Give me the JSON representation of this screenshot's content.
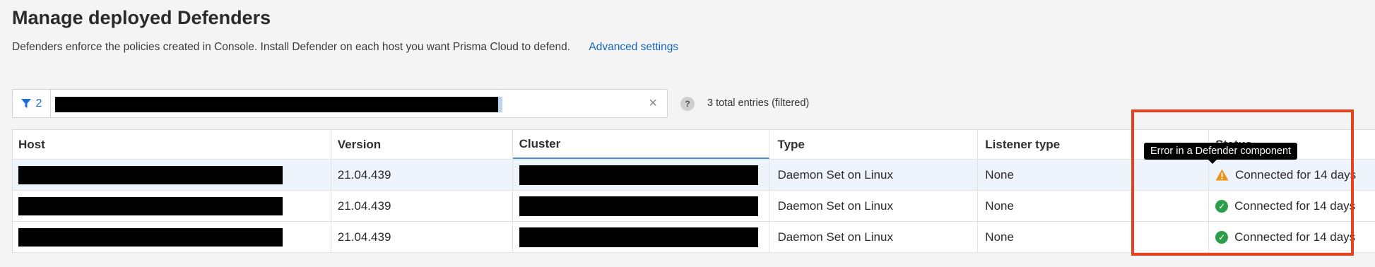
{
  "page": {
    "title": "Manage deployed Defenders",
    "description": "Defenders enforce the policies created in Console. Install Defender on each host you want Prisma Cloud to defend.",
    "advanced_link": "Advanced settings"
  },
  "filter": {
    "count": "2",
    "value": "",
    "clear_symbol": "×",
    "help_symbol": "?",
    "entries_text": "3 total entries (filtered)"
  },
  "table": {
    "columns": [
      "Host",
      "Version",
      "Cluster",
      "Type",
      "Listener type",
      "Status"
    ],
    "rows": [
      {
        "version": "21.04.439",
        "type": "Daemon Set on Linux",
        "listener": "None",
        "status": "Connected for 14 days",
        "status_icon": "warning-icon"
      },
      {
        "version": "21.04.439",
        "type": "Daemon Set on Linux",
        "listener": "None",
        "status": "Connected for 14 days",
        "status_icon": "check-circle-icon"
      },
      {
        "version": "21.04.439",
        "type": "Daemon Set on Linux",
        "listener": "None",
        "status": "Connected for 14 days",
        "status_icon": "check-circle-icon"
      }
    ]
  },
  "tooltip": {
    "text": "Error in a Defender component"
  },
  "colors": {
    "accent": "#1e6fd9",
    "success": "#2e9d4a",
    "warning": "#e8941a",
    "annotation": "#e8431f"
  }
}
